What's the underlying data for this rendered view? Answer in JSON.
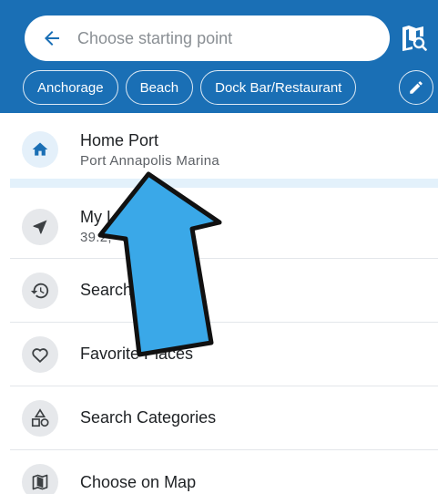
{
  "search": {
    "placeholder": "Choose starting point",
    "back_icon": "arrow-left-icon",
    "map_search_icon": "map-search-icon"
  },
  "chips": [
    {
      "label": "Anchorage"
    },
    {
      "label": "Beach"
    },
    {
      "label": "Dock Bar/Restaurant"
    }
  ],
  "chip_edit_icon": "pencil-icon",
  "rows": {
    "home": {
      "title": "Home Port",
      "subtitle": "Port Annapolis Marina",
      "icon": "home-icon"
    },
    "location": {
      "title": "My Location",
      "subtitle": "39.2, -76.480513",
      "icon": "navigation-arrow-icon"
    },
    "history": {
      "title": "Search History",
      "icon": "history-icon"
    },
    "favorites": {
      "title": "Favorite Places",
      "icon": "heart-icon"
    },
    "categories": {
      "title": "Search Categories",
      "icon": "shapes-icon"
    },
    "map": {
      "title": "Choose on Map",
      "icon": "map-icon"
    }
  },
  "colors": {
    "header": "#1a6fb5",
    "accent_blue": "#1a6fb5",
    "annotation_arrow": "#3aa8e8"
  }
}
